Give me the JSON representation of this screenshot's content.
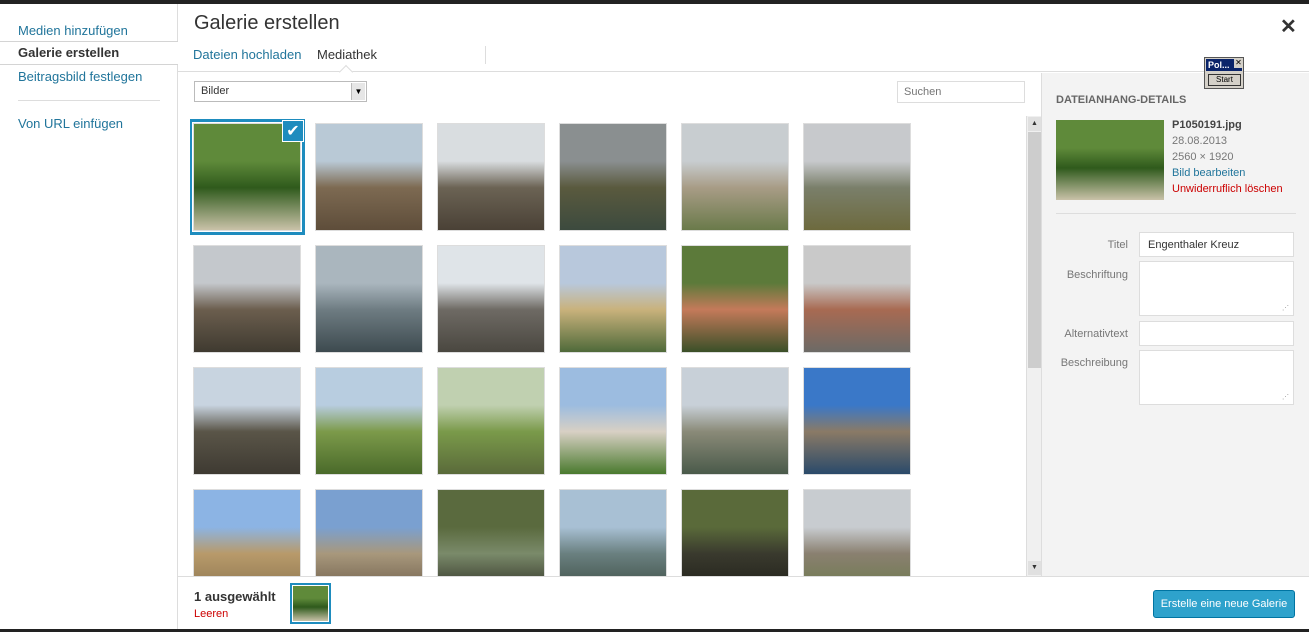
{
  "menu": {
    "items": [
      {
        "label": "Medien hinzufügen",
        "active": false
      },
      {
        "label": "Galerie erstellen",
        "active": true
      },
      {
        "label": "Beitragsbild festlegen",
        "active": false
      },
      {
        "label": "Von URL einfügen",
        "active": false
      }
    ]
  },
  "frame": {
    "title": "Galerie erstellen",
    "close_glyph": "✕",
    "tabs": [
      {
        "label": "Dateien hochladen",
        "active": false
      },
      {
        "label": "Mediathek",
        "active": true
      }
    ]
  },
  "toolbar": {
    "filter_value": "Bilder",
    "filter_arrow": "▼",
    "search_placeholder": "Suchen"
  },
  "grid": {
    "selected_index": 0,
    "check_glyph": "✔",
    "thumbnails": [
      {
        "name": "thumb-forest-monument",
        "colors": [
          "#5f8a3a",
          "#2f5a1c",
          "#c9c2a8"
        ]
      },
      {
        "name": "thumb-field-village",
        "colors": [
          "#b9c9d6",
          "#7d6a52",
          "#5e4d3a"
        ]
      },
      {
        "name": "thumb-castle-ruin",
        "colors": [
          "#d9dde0",
          "#6b6354",
          "#4a4136"
        ]
      },
      {
        "name": "thumb-bridge-river",
        "colors": [
          "#8a8f90",
          "#5a5a3e",
          "#3c4a3e"
        ]
      },
      {
        "name": "thumb-village-street",
        "colors": [
          "#c8cdd0",
          "#a89c86",
          "#6a7a4a"
        ]
      },
      {
        "name": "thumb-hills-cloudy",
        "colors": [
          "#c7c9cc",
          "#7a7f6a",
          "#6d6a3e"
        ]
      },
      {
        "name": "thumb-town-view",
        "colors": [
          "#c4c8cc",
          "#6b5e4e",
          "#3f3a30"
        ]
      },
      {
        "name": "thumb-misty-valley",
        "colors": [
          "#aab6be",
          "#6e7c82",
          "#3d4a4f"
        ]
      },
      {
        "name": "thumb-stone-tower",
        "colors": [
          "#dfe4e8",
          "#6e6a64",
          "#4a4740"
        ]
      },
      {
        "name": "thumb-chapel-tower",
        "colors": [
          "#b8c8dc",
          "#c9b27c",
          "#4f6a3a"
        ]
      },
      {
        "name": "thumb-grotto-statue",
        "colors": [
          "#5c7a3a",
          "#c47a5a",
          "#3a5028"
        ]
      },
      {
        "name": "thumb-gate-house",
        "colors": [
          "#c9c9c9",
          "#a86a52",
          "#6c6a66"
        ]
      },
      {
        "name": "thumb-clock-tower",
        "colors": [
          "#c8d4e0",
          "#5a5548",
          "#3e3a32"
        ]
      },
      {
        "name": "thumb-panorama-fields",
        "colors": [
          "#b8cde0",
          "#7c9a4a",
          "#4a6a2a"
        ]
      },
      {
        "name": "thumb-graveyard",
        "colors": [
          "#c0d0b0",
          "#7a9a4a",
          "#5a6a3a"
        ]
      },
      {
        "name": "thumb-small-chapel",
        "colors": [
          "#9cbce0",
          "#d8d0c4",
          "#4a7a2e"
        ]
      },
      {
        "name": "thumb-manor-pond",
        "colors": [
          "#c8d0d8",
          "#8a8a78",
          "#4a5a4a"
        ]
      },
      {
        "name": "thumb-castle-lake",
        "colors": [
          "#3a78c8",
          "#8a7a66",
          "#2a4a6a"
        ]
      },
      {
        "name": "thumb-trees-field",
        "colors": [
          "#8cb4e4",
          "#b89a6a",
          "#8a7450"
        ]
      },
      {
        "name": "thumb-castle-walls",
        "colors": [
          "#7aa0d0",
          "#a8987c",
          "#6a5a48"
        ]
      },
      {
        "name": "thumb-tunnel-plaque",
        "colors": [
          "#5a6a3e",
          "#7a8a6a",
          "#2a2a20"
        ]
      },
      {
        "name": "thumb-distant-hill",
        "colors": [
          "#a8c0d4",
          "#6a8080",
          "#3a4a40"
        ]
      },
      {
        "name": "thumb-culvert",
        "colors": [
          "#5a6a3a",
          "#3a3a2e",
          "#1e1e18"
        ]
      },
      {
        "name": "thumb-stone-wall",
        "colors": [
          "#c8ccd0",
          "#8a8070",
          "#6a7a4a"
        ]
      }
    ]
  },
  "scrollbar": {
    "up": "▲",
    "down": "▼"
  },
  "details": {
    "heading": "DATEIANHANG-DETAILS",
    "thumb_colors": [
      "#5f8a3a",
      "#2f5a1c",
      "#c9c2a8"
    ],
    "filename": "P1050191.jpg",
    "date": "28.08.2013",
    "dimensions": "2560 × 1920",
    "edit_link": "Bild bearbeiten",
    "delete_link": "Unwiderruflich löschen",
    "resize_glyph": "⋰",
    "fields": [
      {
        "label": "Titel",
        "value": "Engenthaler Kreuz"
      },
      {
        "label": "Beschriftung",
        "value": ""
      },
      {
        "label": "Alternativtext",
        "value": ""
      },
      {
        "label": "Beschreibung",
        "value": ""
      }
    ]
  },
  "bottom": {
    "selection_count": "1 ausgewählt",
    "clear_label": "Leeren",
    "create_button": "Erstelle eine neue Galerie"
  },
  "widget": {
    "title": "Pol...",
    "close": "✕",
    "button": "Start"
  }
}
